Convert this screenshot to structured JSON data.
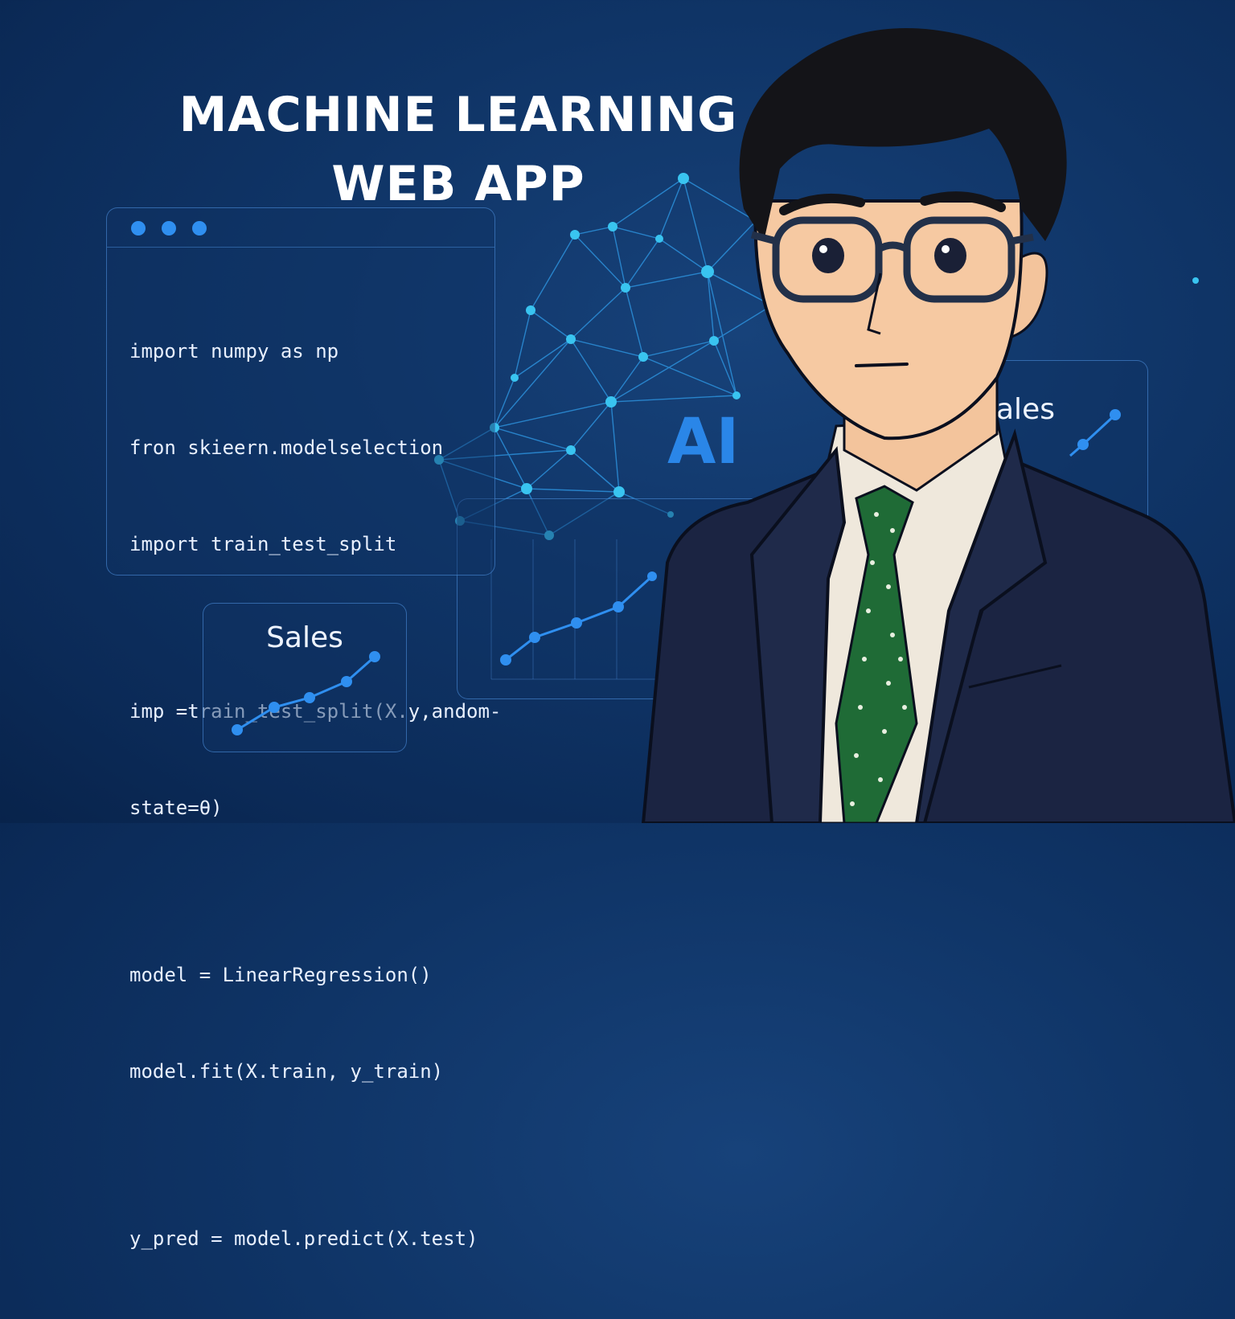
{
  "title": {
    "line1": "MACHINE LEARNING",
    "line2": "WEB APP"
  },
  "code_window": {
    "lines": [
      "import numpy as np",
      "fron skieern.modelselection",
      "import train_test_split",
      "imp =train_test_split(X.y,andom-",
      "state=θ)",
      "model = LinearRegression()",
      "model.fit(X.train, y_train)",
      "y_pred = model.predict(X.test)"
    ]
  },
  "cards": {
    "sales_label": "Sales",
    "right_label": "ales",
    "ai_label": "AI"
  },
  "colors": {
    "background": "#0f3466",
    "accent": "#2f8ff0",
    "node": "#39c4f0",
    "suit": "#1b2442",
    "tie": "#1f6b36"
  },
  "icons": [
    "window-control-dot",
    "neural-network-graphic",
    "line-chart",
    "person-illustration"
  ]
}
